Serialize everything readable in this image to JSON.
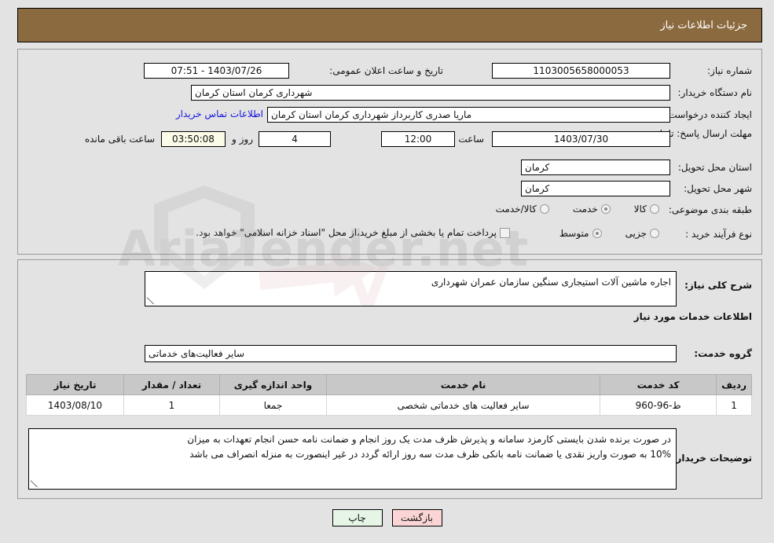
{
  "header": {
    "title": "جزئیات اطلاعات نیاز"
  },
  "top": {
    "need_number_label": "شماره نیاز:",
    "need_number_value": "1103005658000053",
    "announce_label": "تاریخ و ساعت اعلان عمومی:",
    "announce_value": "1403/07/26 - 07:51",
    "buyer_org_label": "نام دستگاه خریدار:",
    "buyer_org_value": "شهرداری کرمان استان کرمان",
    "requester_label": "ایجاد کننده درخواست:",
    "requester_value": "ماریا صدری کاربرداز شهرداری کرمان استان کرمان",
    "contact_link": "اطلاعات تماس خریدار",
    "deadline_label": "مهلت ارسال پاسخ: تا تاریخ:",
    "deadline_date": "1403/07/30",
    "hour_label": "ساعت",
    "hour_value": "12:00",
    "days_value": "4",
    "days_label": "روز و",
    "countdown_value": "03:50:08",
    "remaining_label": "ساعت باقی مانده",
    "province_label": "استان محل تحویل:",
    "province_value": "کرمان",
    "city_label": "شهر محل تحویل:",
    "city_value": "کرمان",
    "category_label": "طبقه بندی موضوعی:",
    "category_options": [
      {
        "label": "کالا",
        "selected": false
      },
      {
        "label": "خدمت",
        "selected": true
      },
      {
        "label": "کالا/خدمت",
        "selected": false
      }
    ],
    "process_label": "نوع فرآیند خرید :",
    "process_options": [
      {
        "label": "جزیی",
        "selected": false
      },
      {
        "label": "متوسط",
        "selected": true
      }
    ],
    "treasury_checkbox_checked": false,
    "treasury_text": "پرداخت تمام یا بخشی از مبلغ خرید،از محل \"اسناد خزانه اسلامی\" خواهد بود."
  },
  "bottom": {
    "general_desc_label": "شرح کلی نیاز:",
    "general_desc_value": "اجاره ماشین آلات استیجاری سنگین سازمان عمران شهرداری",
    "services_section_title": "اطلاعات خدمات مورد نیاز",
    "service_group_label": "گروه خدمت:",
    "service_group_value": "سایر فعالیت‌های خدماتی",
    "table": {
      "headers": [
        "ردیف",
        "کد خدمت",
        "نام خدمت",
        "واحد اندازه گیری",
        "تعداد / مقدار",
        "تاریخ نیاز"
      ],
      "rows": [
        [
          "1",
          "ط-96-960",
          "سایر فعالیت های خدماتی شخصی",
          "جمعا",
          "1",
          "1403/08/10"
        ]
      ]
    },
    "buyer_notes_label": "توضیحات خریدار:",
    "buyer_notes_line1": "در صورت برنده شدن بایستی کارمزد سامانه و پذیرش ظرف مدت یک روز انجام و ضمانت نامه حسن انجام تعهدات به میزان",
    "buyer_notes_line2": "10%  به صورت واریز نقدی یا ضمانت نامه بانکی ظرف مدت سه روز ارائه گردد در غیر اینصورت به منزله انصراف می باشد"
  },
  "buttons": {
    "print_label": "چاپ",
    "back_label": "بازگشت"
  },
  "watermark": {
    "text": "AriaTender.net"
  },
  "colors": {
    "header_brown": "#8c6a3f",
    "page_bg": "#e3e3e3",
    "link_blue": "#1414e0",
    "back_button": "#fbd5d5",
    "print_button": "#e6f5e6"
  }
}
